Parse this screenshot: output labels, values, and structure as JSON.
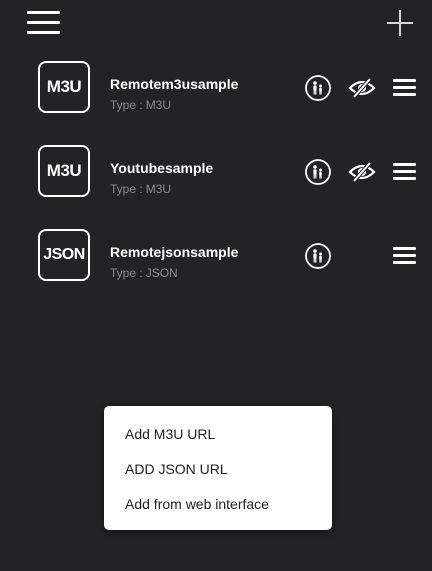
{
  "header": {
    "menu_icon": "hamburger-icon",
    "add_icon": "plus-icon"
  },
  "playlists": [
    {
      "badge": "M3U",
      "name": "Remotem3usample",
      "type_label": "Type :",
      "type_value": "M3U",
      "parental_icon": "family-icon",
      "hidden_icon": "eye-slash-icon",
      "drag_icon": "drag-handle-icon"
    },
    {
      "badge": "M3U",
      "name": "Youtubesample",
      "type_label": "Type :",
      "type_value": "M3U",
      "parental_icon": "family-icon",
      "hidden_icon": "eye-slash-icon",
      "drag_icon": "drag-handle-icon"
    },
    {
      "badge": "JSON",
      "name": "Remotejsonsample",
      "type_label": "Type :",
      "type_value": "JSON",
      "parental_icon": "family-icon",
      "drag_icon": "drag-handle-icon"
    }
  ],
  "add_menu": {
    "items": [
      "Add M3U URL",
      "ADD JSON URL",
      "Add from web interface"
    ]
  },
  "colors": {
    "background": "#232325",
    "foreground": "#ffffff",
    "subtext": "#8a8a8a",
    "menu_background": "#ffffff",
    "menu_text": "#222222"
  }
}
